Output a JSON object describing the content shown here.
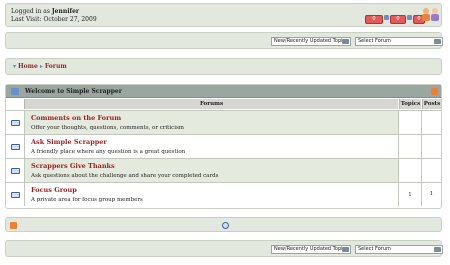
{
  "header": {
    "logged_in_prefix": "Logged in as ",
    "username": "Jennifer",
    "last_visit": "Last Visit: October 27, 2009"
  },
  "jump": {
    "recent_option": "New/Recently Updated Topics",
    "forum_option": "Select Forum"
  },
  "breadcrumb": {
    "home": "Home",
    "forum": "Forum"
  },
  "forum": {
    "title": "Welcome to Simple Scrapper",
    "columns": {
      "forums": "Forums",
      "topics": "Topics",
      "posts": "Posts"
    },
    "rows": [
      {
        "name": "Comments on the Forum",
        "desc": "Offer your thoughts, questions, comments, or criticism",
        "topics": "",
        "posts": ""
      },
      {
        "name": "Ask Simple Scrapper",
        "desc": "A friendly place where any question is a great question",
        "topics": "",
        "posts": ""
      },
      {
        "name": "Scrappers Give Thanks",
        "desc": "Ask questions about the challenge and share your completed cards",
        "topics": "",
        "posts": ""
      },
      {
        "name": "Focus Group",
        "desc": "A private area for focus group members",
        "topics": "1",
        "posts": "1"
      }
    ]
  },
  "colors": {
    "accent": "#9b1c1c",
    "panel": "#e3e8df",
    "header": "#9aa7a0"
  }
}
